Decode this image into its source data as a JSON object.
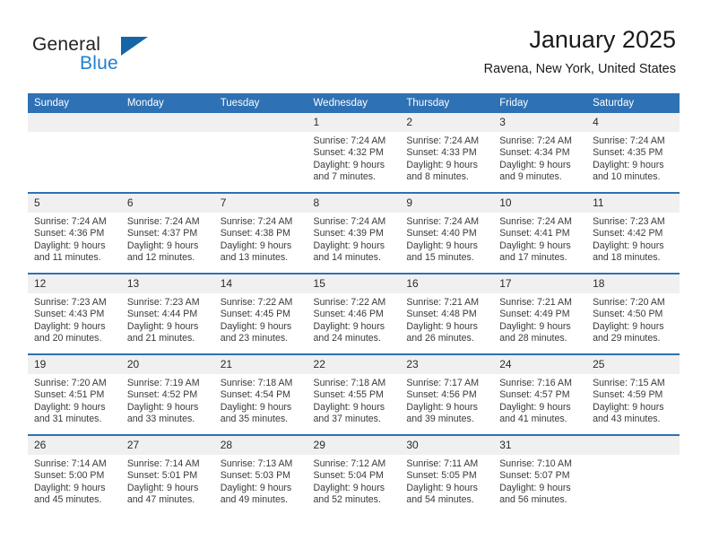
{
  "brand": {
    "line1": "General",
    "line2": "Blue",
    "triangle_color": "#1565a8"
  },
  "header": {
    "title": "January 2025",
    "subtitle": "Ravena, New York, United States"
  },
  "theme": {
    "header_blue": "#2e71b4",
    "daynum_gray": "#f0f0f0",
    "text": "#1a1a1a"
  },
  "weekday_headers": [
    "Sunday",
    "Monday",
    "Tuesday",
    "Wednesday",
    "Thursday",
    "Friday",
    "Saturday"
  ],
  "weeks": [
    [
      {
        "day": "",
        "sunrise": "",
        "sunset": "",
        "daylight": "",
        "daylight2": ""
      },
      {
        "day": "",
        "sunrise": "",
        "sunset": "",
        "daylight": "",
        "daylight2": ""
      },
      {
        "day": "",
        "sunrise": "",
        "sunset": "",
        "daylight": "",
        "daylight2": ""
      },
      {
        "day": "1",
        "sunrise": "Sunrise: 7:24 AM",
        "sunset": "Sunset: 4:32 PM",
        "daylight": "Daylight: 9 hours",
        "daylight2": "and 7 minutes."
      },
      {
        "day": "2",
        "sunrise": "Sunrise: 7:24 AM",
        "sunset": "Sunset: 4:33 PM",
        "daylight": "Daylight: 9 hours",
        "daylight2": "and 8 minutes."
      },
      {
        "day": "3",
        "sunrise": "Sunrise: 7:24 AM",
        "sunset": "Sunset: 4:34 PM",
        "daylight": "Daylight: 9 hours",
        "daylight2": "and 9 minutes."
      },
      {
        "day": "4",
        "sunrise": "Sunrise: 7:24 AM",
        "sunset": "Sunset: 4:35 PM",
        "daylight": "Daylight: 9 hours",
        "daylight2": "and 10 minutes."
      }
    ],
    [
      {
        "day": "5",
        "sunrise": "Sunrise: 7:24 AM",
        "sunset": "Sunset: 4:36 PM",
        "daylight": "Daylight: 9 hours",
        "daylight2": "and 11 minutes."
      },
      {
        "day": "6",
        "sunrise": "Sunrise: 7:24 AM",
        "sunset": "Sunset: 4:37 PM",
        "daylight": "Daylight: 9 hours",
        "daylight2": "and 12 minutes."
      },
      {
        "day": "7",
        "sunrise": "Sunrise: 7:24 AM",
        "sunset": "Sunset: 4:38 PM",
        "daylight": "Daylight: 9 hours",
        "daylight2": "and 13 minutes."
      },
      {
        "day": "8",
        "sunrise": "Sunrise: 7:24 AM",
        "sunset": "Sunset: 4:39 PM",
        "daylight": "Daylight: 9 hours",
        "daylight2": "and 14 minutes."
      },
      {
        "day": "9",
        "sunrise": "Sunrise: 7:24 AM",
        "sunset": "Sunset: 4:40 PM",
        "daylight": "Daylight: 9 hours",
        "daylight2": "and 15 minutes."
      },
      {
        "day": "10",
        "sunrise": "Sunrise: 7:24 AM",
        "sunset": "Sunset: 4:41 PM",
        "daylight": "Daylight: 9 hours",
        "daylight2": "and 17 minutes."
      },
      {
        "day": "11",
        "sunrise": "Sunrise: 7:23 AM",
        "sunset": "Sunset: 4:42 PM",
        "daylight": "Daylight: 9 hours",
        "daylight2": "and 18 minutes."
      }
    ],
    [
      {
        "day": "12",
        "sunrise": "Sunrise: 7:23 AM",
        "sunset": "Sunset: 4:43 PM",
        "daylight": "Daylight: 9 hours",
        "daylight2": "and 20 minutes."
      },
      {
        "day": "13",
        "sunrise": "Sunrise: 7:23 AM",
        "sunset": "Sunset: 4:44 PM",
        "daylight": "Daylight: 9 hours",
        "daylight2": "and 21 minutes."
      },
      {
        "day": "14",
        "sunrise": "Sunrise: 7:22 AM",
        "sunset": "Sunset: 4:45 PM",
        "daylight": "Daylight: 9 hours",
        "daylight2": "and 23 minutes."
      },
      {
        "day": "15",
        "sunrise": "Sunrise: 7:22 AM",
        "sunset": "Sunset: 4:46 PM",
        "daylight": "Daylight: 9 hours",
        "daylight2": "and 24 minutes."
      },
      {
        "day": "16",
        "sunrise": "Sunrise: 7:21 AM",
        "sunset": "Sunset: 4:48 PM",
        "daylight": "Daylight: 9 hours",
        "daylight2": "and 26 minutes."
      },
      {
        "day": "17",
        "sunrise": "Sunrise: 7:21 AM",
        "sunset": "Sunset: 4:49 PM",
        "daylight": "Daylight: 9 hours",
        "daylight2": "and 28 minutes."
      },
      {
        "day": "18",
        "sunrise": "Sunrise: 7:20 AM",
        "sunset": "Sunset: 4:50 PM",
        "daylight": "Daylight: 9 hours",
        "daylight2": "and 29 minutes."
      }
    ],
    [
      {
        "day": "19",
        "sunrise": "Sunrise: 7:20 AM",
        "sunset": "Sunset: 4:51 PM",
        "daylight": "Daylight: 9 hours",
        "daylight2": "and 31 minutes."
      },
      {
        "day": "20",
        "sunrise": "Sunrise: 7:19 AM",
        "sunset": "Sunset: 4:52 PM",
        "daylight": "Daylight: 9 hours",
        "daylight2": "and 33 minutes."
      },
      {
        "day": "21",
        "sunrise": "Sunrise: 7:18 AM",
        "sunset": "Sunset: 4:54 PM",
        "daylight": "Daylight: 9 hours",
        "daylight2": "and 35 minutes."
      },
      {
        "day": "22",
        "sunrise": "Sunrise: 7:18 AM",
        "sunset": "Sunset: 4:55 PM",
        "daylight": "Daylight: 9 hours",
        "daylight2": "and 37 minutes."
      },
      {
        "day": "23",
        "sunrise": "Sunrise: 7:17 AM",
        "sunset": "Sunset: 4:56 PM",
        "daylight": "Daylight: 9 hours",
        "daylight2": "and 39 minutes."
      },
      {
        "day": "24",
        "sunrise": "Sunrise: 7:16 AM",
        "sunset": "Sunset: 4:57 PM",
        "daylight": "Daylight: 9 hours",
        "daylight2": "and 41 minutes."
      },
      {
        "day": "25",
        "sunrise": "Sunrise: 7:15 AM",
        "sunset": "Sunset: 4:59 PM",
        "daylight": "Daylight: 9 hours",
        "daylight2": "and 43 minutes."
      }
    ],
    [
      {
        "day": "26",
        "sunrise": "Sunrise: 7:14 AM",
        "sunset": "Sunset: 5:00 PM",
        "daylight": "Daylight: 9 hours",
        "daylight2": "and 45 minutes."
      },
      {
        "day": "27",
        "sunrise": "Sunrise: 7:14 AM",
        "sunset": "Sunset: 5:01 PM",
        "daylight": "Daylight: 9 hours",
        "daylight2": "and 47 minutes."
      },
      {
        "day": "28",
        "sunrise": "Sunrise: 7:13 AM",
        "sunset": "Sunset: 5:03 PM",
        "daylight": "Daylight: 9 hours",
        "daylight2": "and 49 minutes."
      },
      {
        "day": "29",
        "sunrise": "Sunrise: 7:12 AM",
        "sunset": "Sunset: 5:04 PM",
        "daylight": "Daylight: 9 hours",
        "daylight2": "and 52 minutes."
      },
      {
        "day": "30",
        "sunrise": "Sunrise: 7:11 AM",
        "sunset": "Sunset: 5:05 PM",
        "daylight": "Daylight: 9 hours",
        "daylight2": "and 54 minutes."
      },
      {
        "day": "31",
        "sunrise": "Sunrise: 7:10 AM",
        "sunset": "Sunset: 5:07 PM",
        "daylight": "Daylight: 9 hours",
        "daylight2": "and 56 minutes."
      },
      {
        "day": "",
        "sunrise": "",
        "sunset": "",
        "daylight": "",
        "daylight2": ""
      }
    ]
  ]
}
